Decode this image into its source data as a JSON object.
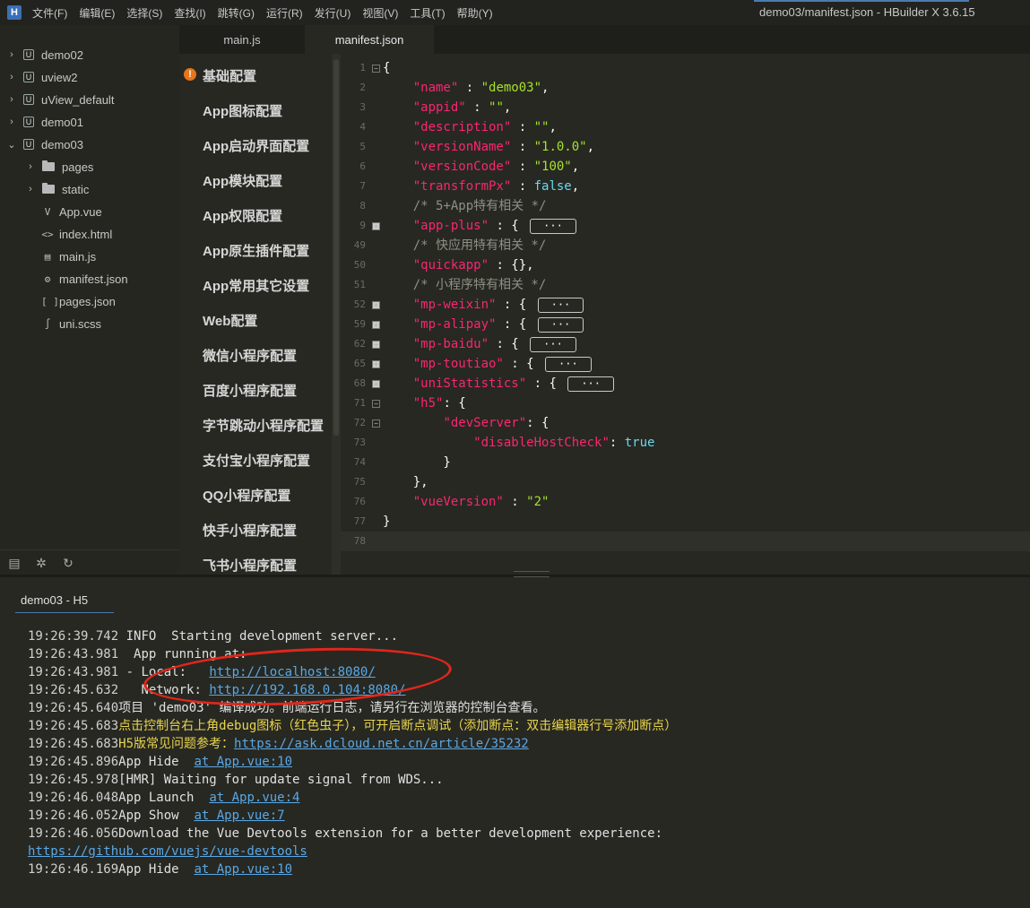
{
  "menubar": {
    "logo": "H",
    "items": [
      "文件(F)",
      "编辑(E)",
      "选择(S)",
      "查找(I)",
      "跳转(G)",
      "运行(R)",
      "发行(U)",
      "视图(V)",
      "工具(T)",
      "帮助(Y)"
    ],
    "window_title": "demo03/manifest.json - HBuilder X 3.6.15"
  },
  "tree": {
    "projects": [
      {
        "label": "demo02",
        "expanded": false
      },
      {
        "label": "uview2",
        "expanded": false
      },
      {
        "label": "uView_default",
        "expanded": false
      },
      {
        "label": "demo01",
        "expanded": false
      },
      {
        "label": "demo03",
        "expanded": true
      }
    ],
    "folders": [
      "pages",
      "static"
    ],
    "files": [
      {
        "label": "App.vue",
        "icon": "V"
      },
      {
        "label": "index.html",
        "icon": "<>"
      },
      {
        "label": "main.js",
        "icon": "▤"
      },
      {
        "label": "manifest.json",
        "icon": "⚙"
      },
      {
        "label": "pages.json",
        "icon": "[ ]"
      },
      {
        "label": "uni.scss",
        "icon": "∫"
      }
    ]
  },
  "tabs": [
    {
      "label": "main.js",
      "active": false
    },
    {
      "label": "manifest.json",
      "active": true
    }
  ],
  "settings_nav": {
    "items": [
      "基础配置",
      "App图标配置",
      "App启动界面配置",
      "App模块配置",
      "App权限配置",
      "App原生插件配置",
      "App常用其它设置",
      "Web配置",
      "微信小程序配置",
      "百度小程序配置",
      "字节跳动小程序配置",
      "支付宝小程序配置",
      "QQ小程序配置",
      "快手小程序配置",
      "飞书小程序配置"
    ]
  },
  "editor": {
    "line_numbers": [
      "1",
      "2",
      "3",
      "4",
      "5",
      "6",
      "7",
      "8",
      "9",
      "49",
      "50",
      "51",
      "52",
      "59",
      "62",
      "65",
      "68",
      "71",
      "72",
      "73",
      "74",
      "75",
      "76",
      "77",
      "78"
    ],
    "fold_ellipsis": "···"
  },
  "console": {
    "tab_label": "demo03 - H5",
    "lines": [
      {
        "ts": "19:26:39.742",
        "text": " INFO  Starting development server..."
      },
      {
        "ts": "19:26:43.981",
        "text": "  App running at:"
      },
      {
        "ts": "19:26:43.981",
        "text": " - Local:   ",
        "link": "http://localhost:8080/"
      },
      {
        "ts": "19:26:45.632",
        "text": "   Network: ",
        "link": "http://192.168.0.104:8080/"
      },
      {
        "ts": "19:26:45.640",
        "text": "项目 'demo03' 编译成功。前端运行日志，请另行在浏览器的控制台查看。"
      },
      {
        "ts": "19:26:45.683",
        "yellow": "点击控制台右上角debug图标（红色虫子），可开启断点调试（添加断点：双击编辑器行号添加断点）"
      },
      {
        "ts": "19:26:45.683",
        "yellow": "H5版常见问题参考：",
        "link": "https://ask.dcloud.net.cn/article/35232"
      },
      {
        "ts": "19:26:45.896",
        "text": "App Hide  ",
        "link": "at App.vue:10"
      },
      {
        "ts": "19:26:45.978",
        "text": "[HMR] Waiting for update signal from WDS..."
      },
      {
        "ts": "19:26:46.048",
        "text": "App Launch  ",
        "link": "at App.vue:4"
      },
      {
        "ts": "19:26:46.052",
        "text": "App Show  ",
        "link": "at App.vue:7"
      },
      {
        "ts": "19:26:46.056",
        "text": "Download the Vue Devtools extension for a better development experience:"
      },
      {
        "ts": "",
        "text": "",
        "link": "https://github.com/vuejs/vue-devtools"
      },
      {
        "ts": "19:26:46.169",
        "text": "App Hide  ",
        "link": "at App.vue:10"
      }
    ]
  },
  "colors": {
    "annotation": "#e0261b",
    "link": "#5aa8e6",
    "warning": "#e8741b"
  }
}
